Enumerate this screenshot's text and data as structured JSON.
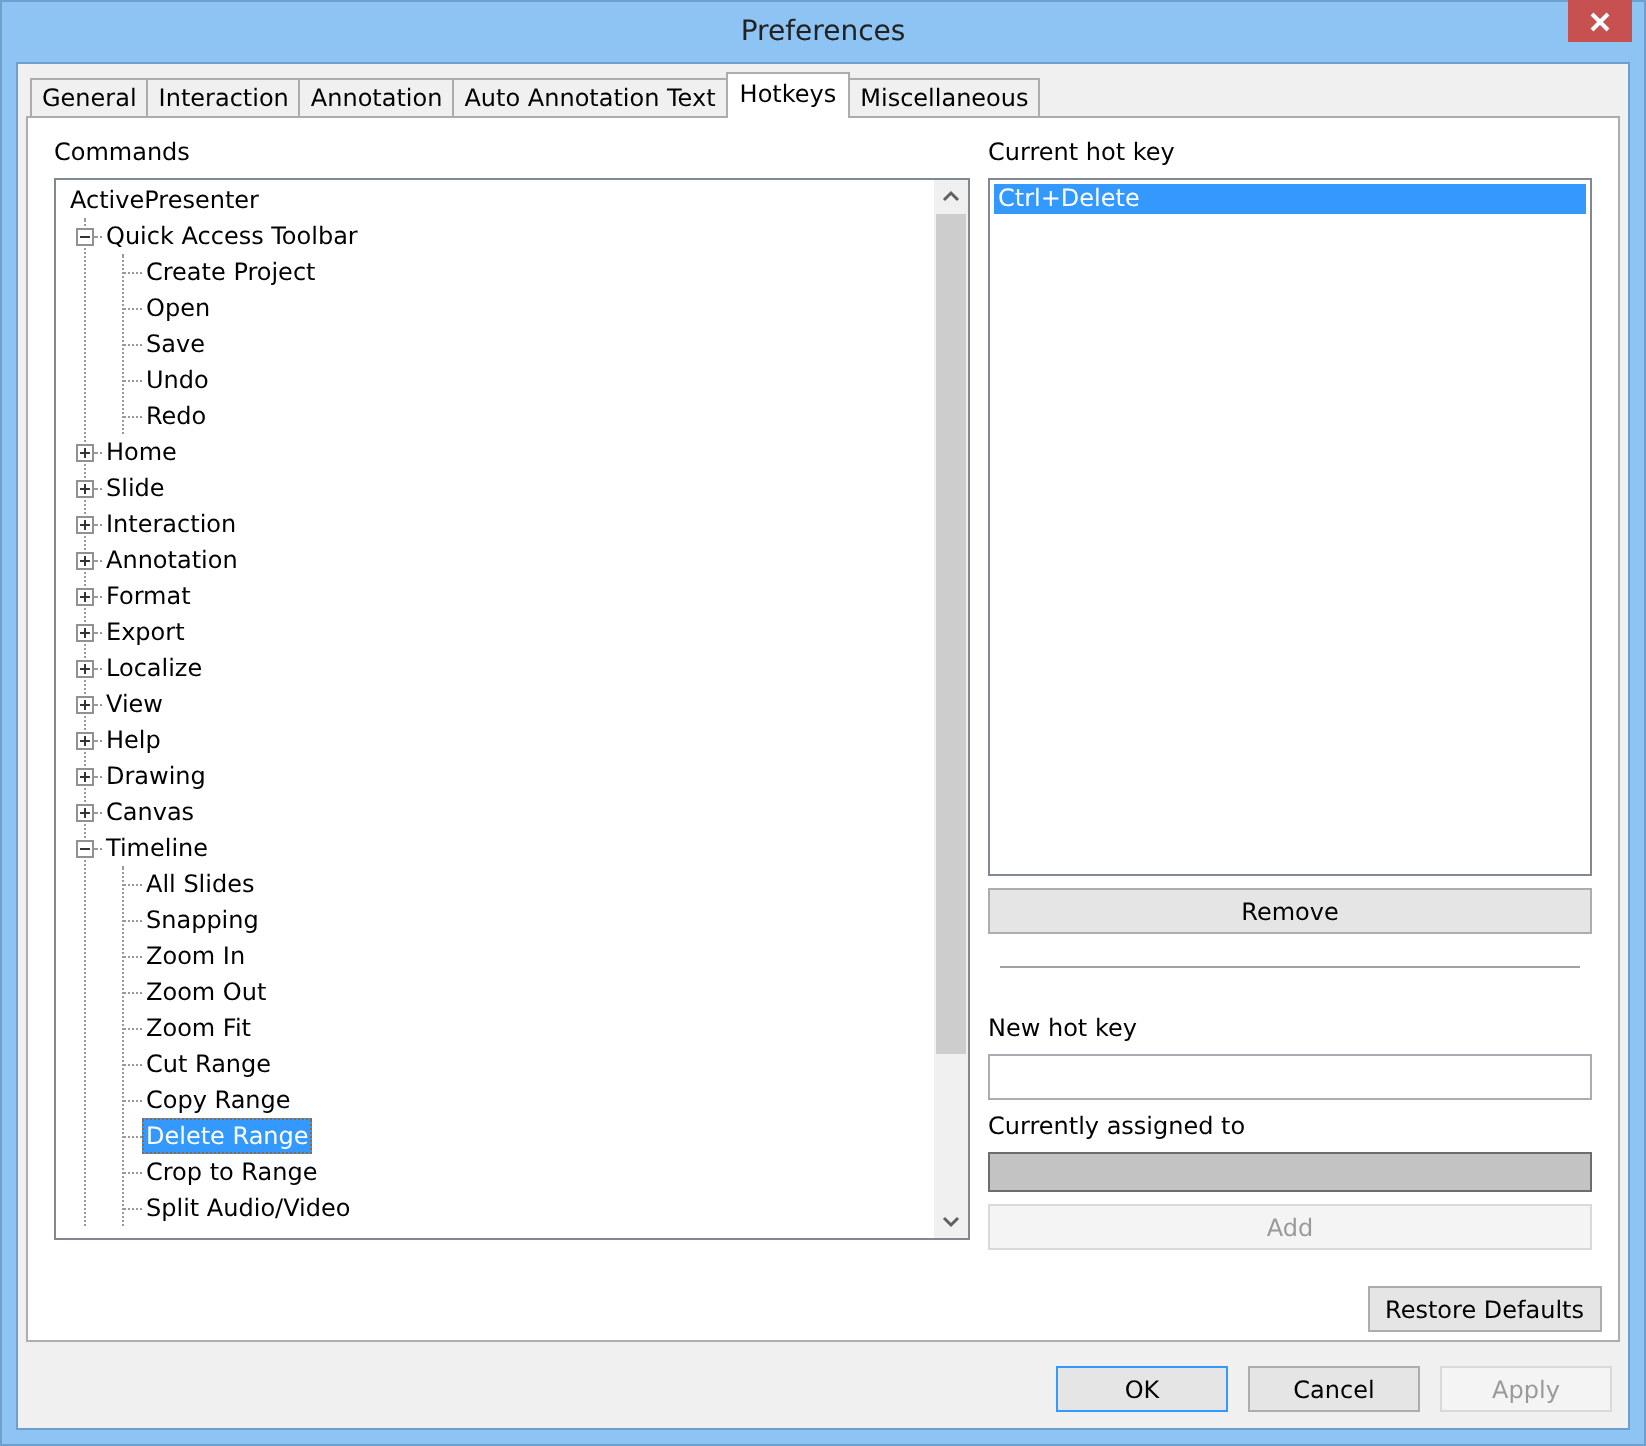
{
  "window": {
    "title": "Preferences"
  },
  "tabs": [
    {
      "label": "General",
      "selected": false
    },
    {
      "label": "Interaction",
      "selected": false
    },
    {
      "label": "Annotation",
      "selected": false
    },
    {
      "label": "Auto Annotation Text",
      "selected": false
    },
    {
      "label": "Hotkeys",
      "selected": true
    },
    {
      "label": "Miscellaneous",
      "selected": false
    }
  ],
  "commands": {
    "label": "Commands",
    "tree": [
      {
        "label": "ActivePresenter",
        "selected": false,
        "children": [
          {
            "label": "Quick Access Toolbar",
            "expanded": true,
            "selected": false,
            "children": [
              {
                "label": "Create Project",
                "selected": false
              },
              {
                "label": "Open",
                "selected": false
              },
              {
                "label": "Save",
                "selected": false
              },
              {
                "label": "Undo",
                "selected": false
              },
              {
                "label": "Redo",
                "selected": false
              }
            ]
          },
          {
            "label": "Home",
            "expanded": false,
            "selected": false
          },
          {
            "label": "Slide",
            "expanded": false,
            "selected": false
          },
          {
            "label": "Interaction",
            "expanded": false,
            "selected": false
          },
          {
            "label": "Annotation",
            "expanded": false,
            "selected": false
          },
          {
            "label": "Format",
            "expanded": false,
            "selected": false
          },
          {
            "label": "Export",
            "expanded": false,
            "selected": false
          },
          {
            "label": "Localize",
            "expanded": false,
            "selected": false
          },
          {
            "label": "View",
            "expanded": false,
            "selected": false
          },
          {
            "label": "Help",
            "expanded": false,
            "selected": false
          },
          {
            "label": "Drawing",
            "expanded": false,
            "selected": false
          },
          {
            "label": "Canvas",
            "expanded": false,
            "selected": false
          },
          {
            "label": "Timeline",
            "expanded": true,
            "selected": false,
            "children": [
              {
                "label": "All Slides",
                "selected": false
              },
              {
                "label": "Snapping",
                "selected": false
              },
              {
                "label": "Zoom In",
                "selected": false
              },
              {
                "label": "Zoom Out",
                "selected": false
              },
              {
                "label": "Zoom Fit",
                "selected": false
              },
              {
                "label": "Cut Range",
                "selected": false
              },
              {
                "label": "Copy Range",
                "selected": false
              },
              {
                "label": "Delete Range",
                "selected": true
              },
              {
                "label": "Crop to Range",
                "selected": false
              },
              {
                "label": "Split Audio/Video",
                "selected": false
              }
            ]
          }
        ]
      }
    ]
  },
  "current_hot_key": {
    "label": "Current hot key",
    "items": [
      {
        "label": "Ctrl+Delete",
        "selected": true
      }
    ],
    "remove_button": {
      "label": "Remove",
      "disabled": false
    }
  },
  "new_hot_key": {
    "label": "New hot key"
  },
  "currently_assigned": {
    "label": "Currently assigned to"
  },
  "add_button": {
    "label": "Add",
    "disabled": true
  },
  "restore_defaults_button": {
    "label": "Restore Defaults",
    "disabled": false
  },
  "buttons": [
    {
      "label": "OK",
      "default": true,
      "disabled": false
    },
    {
      "label": "Cancel",
      "default": false,
      "disabled": false
    },
    {
      "label": "Apply",
      "default": false,
      "disabled": true
    }
  ]
}
